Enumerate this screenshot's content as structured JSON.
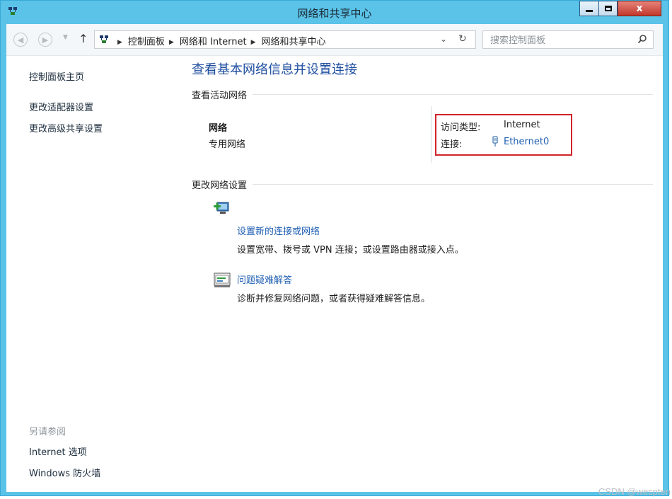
{
  "window": {
    "title": "网络和共享中心",
    "close_glyph": "x"
  },
  "addressbar": {
    "crumbs": [
      "控制面板",
      "网络和 Internet",
      "网络和共享中心"
    ],
    "search_placeholder": "搜索控制面板"
  },
  "sidebar": {
    "home": "控制面板主页",
    "adapter": "更改适配器设置",
    "advanced": "更改高级共享设置",
    "see_also": "另请参阅",
    "internet_options": "Internet 选项",
    "firewall": "Windows 防火墙"
  },
  "main": {
    "title": "查看基本网络信息并设置连接",
    "active_networks_header": "查看活动网络",
    "network": {
      "name": "网络",
      "type": "专用网络",
      "access_label": "访问类型:",
      "access_value": "Internet",
      "connection_label": "连接:",
      "connection_value": "Ethernet0"
    },
    "change_header": "更改网络设置",
    "tasks": [
      {
        "title": "设置新的连接或网络",
        "desc": "设置宽带、拨号或 VPN 连接；或设置路由器或接入点。",
        "icon": "new-connection-icon"
      },
      {
        "title": "问题疑难解答",
        "desc": "诊断并修复网络问题，或者获得疑难解答信息。",
        "icon": "troubleshoot-icon"
      }
    ]
  },
  "watermark": "CSDN @wespten"
}
